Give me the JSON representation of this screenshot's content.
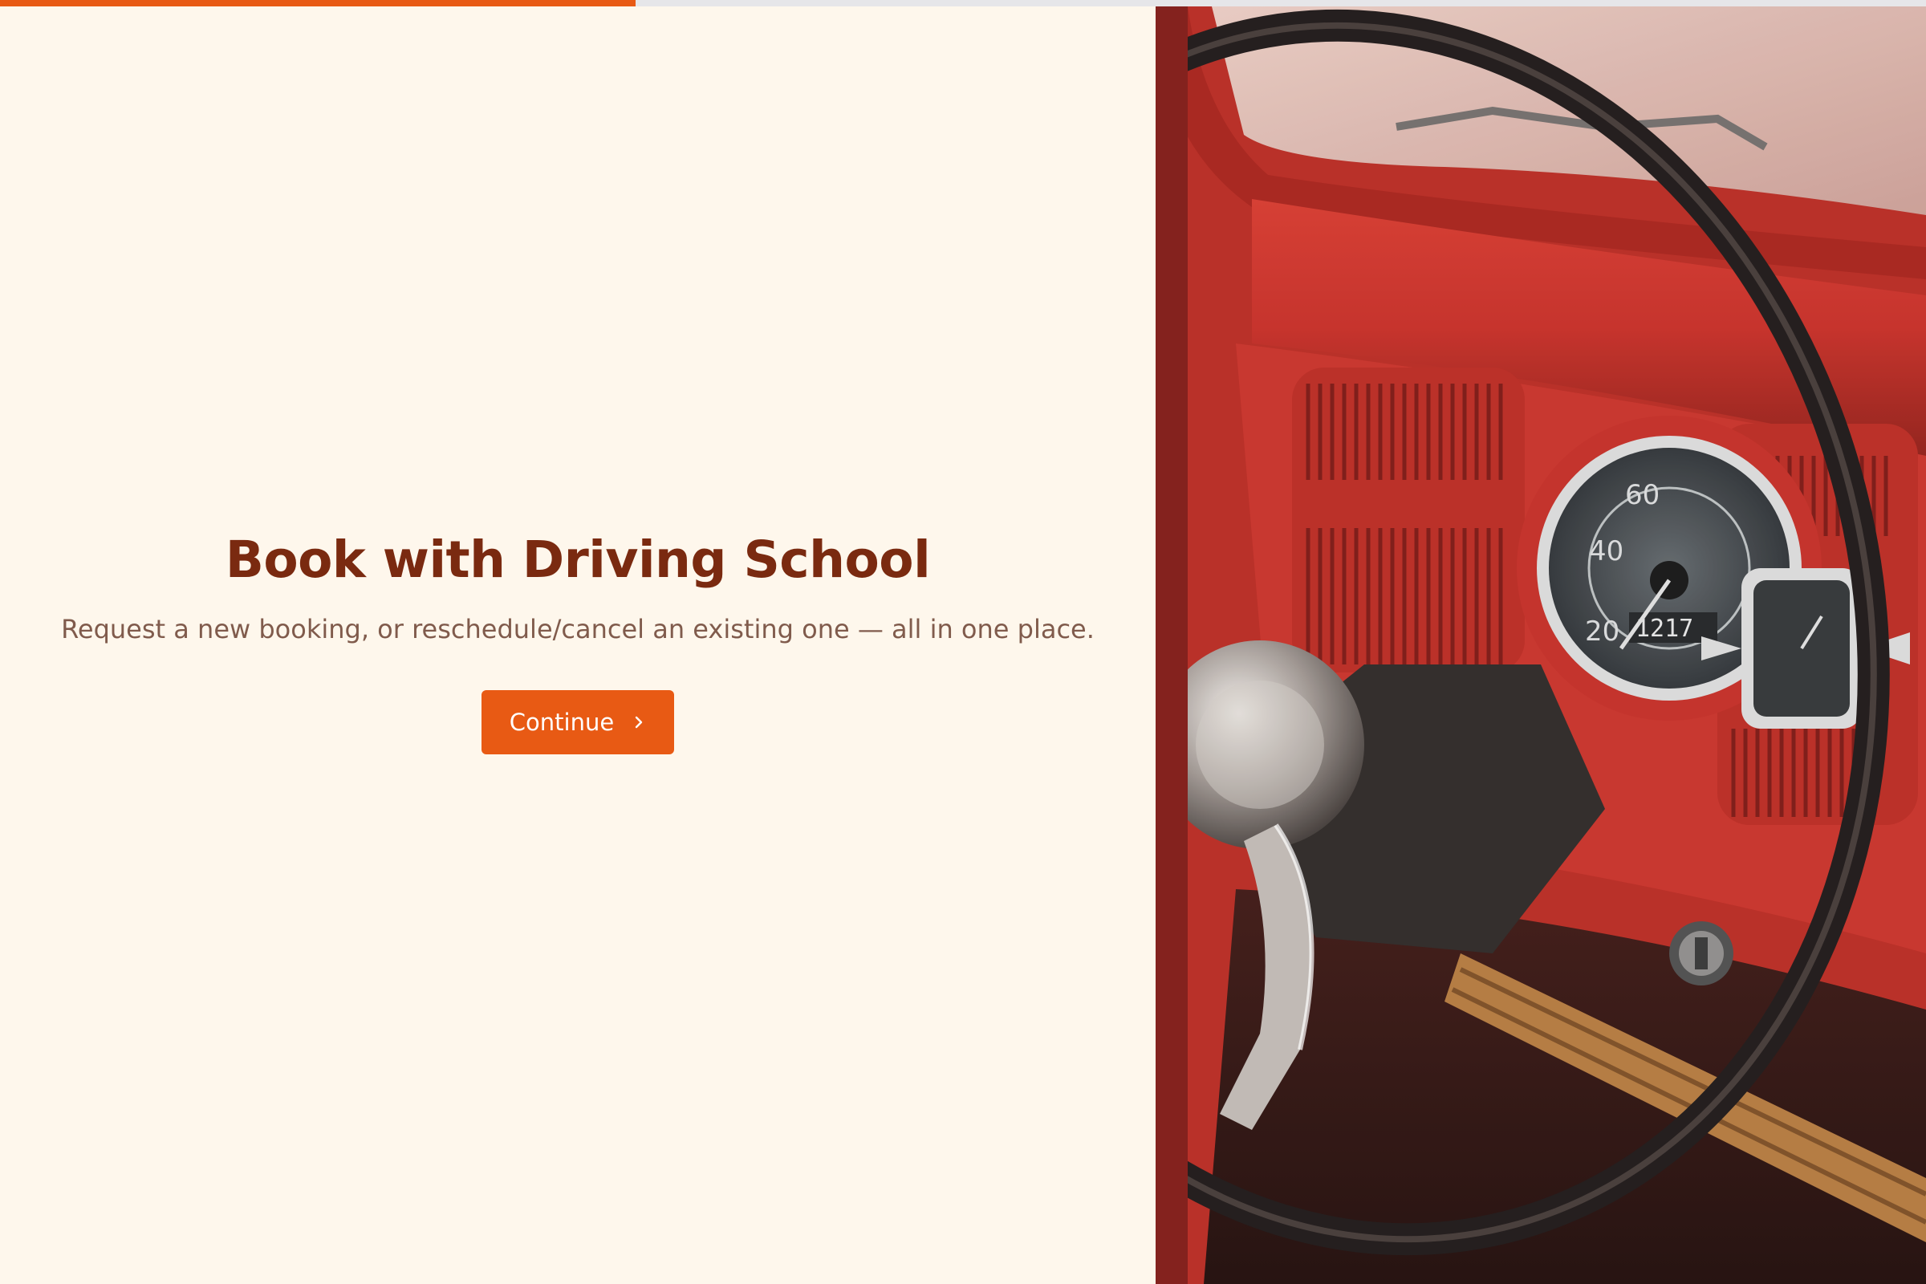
{
  "progress": {
    "value_fraction": 0.33,
    "fill_color": "#E85A14",
    "track_color": "#E6E6E9"
  },
  "hero": {
    "title": "Book with Driving School",
    "subtitle": "Request a new booking, or reschedule/cancel an existing one — all in one place.",
    "continue_label": "Continue",
    "continue_icon": "chevron-right-icon"
  },
  "image": {
    "subject": "red vintage car dashboard with steering wheel"
  },
  "colors": {
    "background": "#FEF7EC",
    "title": "#7A2A10",
    "subtitle": "#805B4C",
    "accent": "#E85A14"
  }
}
